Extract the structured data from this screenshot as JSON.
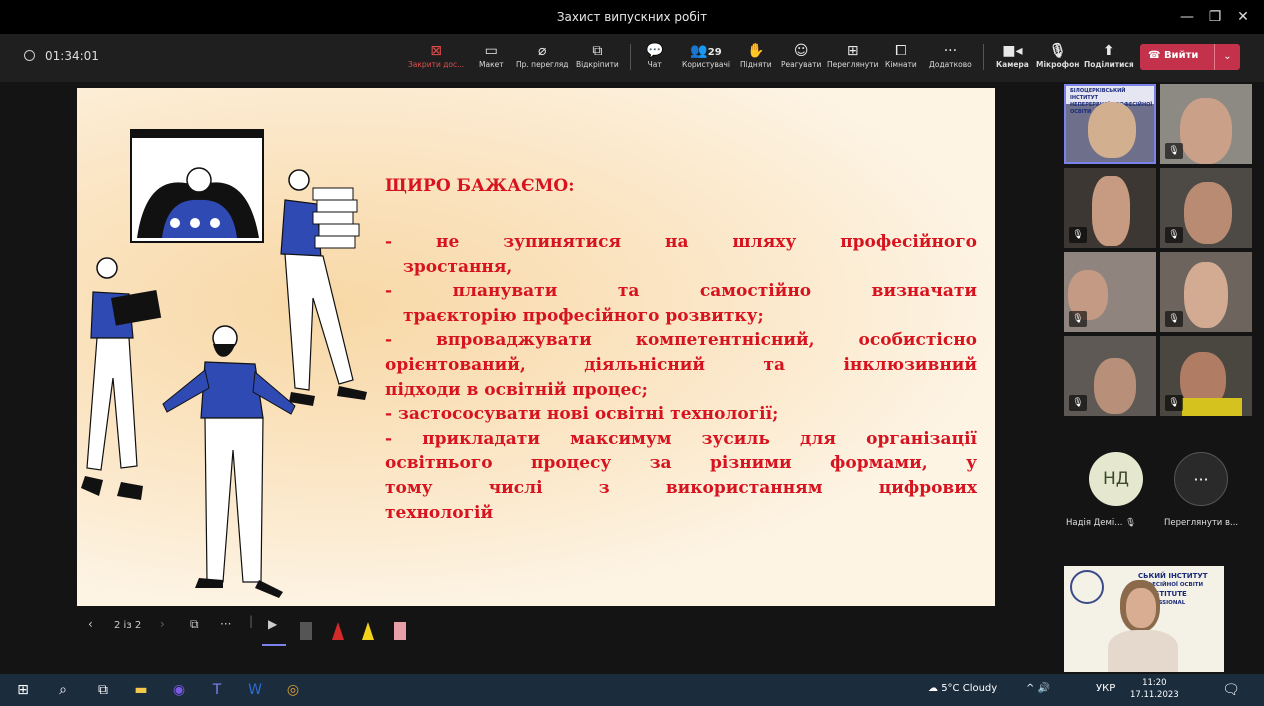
{
  "window": {
    "title": "Захист випускних робіт"
  },
  "toolbar": {
    "timer": "01:34:01",
    "close_share": "Закрити дос...",
    "layout": "Макет",
    "view_mode": "Пр. перегляд",
    "pop_out": "Відкріпити",
    "chat": "Чат",
    "participants_count": "29",
    "participants": "Користувачі",
    "raise": "Підняти",
    "react": "Реагувати",
    "view": "Переглянути",
    "rooms": "Кімнати",
    "more": "Додатково",
    "camera": "Камера",
    "mic": "Мікрофон",
    "share": "Поділитися",
    "leave": "Вийти"
  },
  "slide": {
    "heading": "ЩИРО БАЖАЄМО:",
    "lines": [
      "- не зупинятися на шляху професійного",
      "зростання,",
      "- планувати та самостійно визначати",
      "траєкторію професійного розвитку;",
      "- впроваджувати компетентнісний, особистісно",
      "орієнтований, діяльнісний та інклюзивний",
      "підходи в освітній процес;",
      "- застососувати нові освітні технології;",
      "- прикладати максимум зусиль для організації",
      "освітнього процесу за різними формами, у",
      "тому числі з використанням цифрових",
      "технологій"
    ],
    "page": "2 із 2"
  },
  "gallery": {
    "person1_initials": "НД",
    "person1_name": "Надія Демі...",
    "more_label": "Переглянути в...",
    "banner_l1": "БІЛОЦЕРКІВСЬКИЙ ІНСТИТУТ",
    "banner_l2": "НЕПЕРЕРВНОЇ ПРОФЕСІЙНОЇ ОСВІТИ",
    "banner_right1": "СЬКИЙ ІНСТИТУТ",
    "banner_right2": "РОФЕСІЙНОЇ ОСВІТИ",
    "banner_right3": "A INSTITUTE",
    "banner_right4": "PROFESSIONAL"
  },
  "taskbar": {
    "weather": "5°C Cloudy",
    "lang": "УКР",
    "time": "11:20",
    "date": "17.11.2023"
  },
  "colors": {
    "accent_red": "#d6131e",
    "leave_red": "#c4314b",
    "taskbar": "#1b2c3d"
  }
}
